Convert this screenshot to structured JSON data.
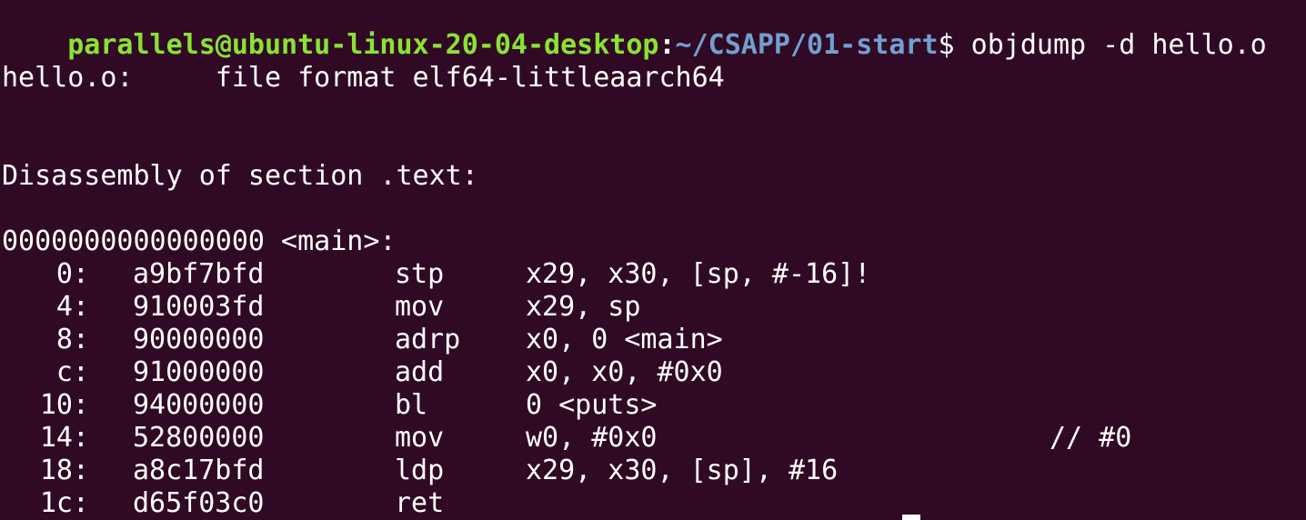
{
  "terminal": {
    "colors": {
      "background": "#300a24",
      "foreground": "#ffffff",
      "prompt_user": "#8ae234",
      "prompt_path": "#729fcf"
    },
    "prompt": {
      "user_host": "parallels@ubuntu-linux-20-04-desktop",
      "colon": ":",
      "path": "~/CSAPP/01-start",
      "symbol": "$",
      "command": " objdump -d hello.o"
    },
    "file_line": "hello.o:     file format elf64-littleaarch64",
    "section_line": "Disassembly of section .text:",
    "symbol_line": "0000000000000000 <main>:",
    "instructions": [
      {
        "offset": "0:",
        "hex": "a9bf7bfd",
        "mnemonic": "stp",
        "operands": "x29, x30, [sp, #-16]!",
        "comment": ""
      },
      {
        "offset": "4:",
        "hex": "910003fd",
        "mnemonic": "mov",
        "operands": "x29, sp",
        "comment": ""
      },
      {
        "offset": "8:",
        "hex": "90000000",
        "mnemonic": "adrp",
        "operands": "x0, 0 <main>",
        "comment": ""
      },
      {
        "offset": "c:",
        "hex": "91000000",
        "mnemonic": "add",
        "operands": "x0, x0, #0x0",
        "comment": ""
      },
      {
        "offset": "10:",
        "hex": "94000000",
        "mnemonic": "bl",
        "operands": "0 <puts>",
        "comment": ""
      },
      {
        "offset": "14:",
        "hex": "52800000",
        "mnemonic": "mov",
        "operands": "w0, #0x0",
        "comment": "// #0"
      },
      {
        "offset": "18:",
        "hex": "a8c17bfd",
        "mnemonic": "ldp",
        "operands": "x29, x30, [sp], #16",
        "comment": ""
      },
      {
        "offset": "1c:",
        "hex": "d65f03c0",
        "mnemonic": "ret",
        "operands": "",
        "comment": ""
      }
    ]
  }
}
